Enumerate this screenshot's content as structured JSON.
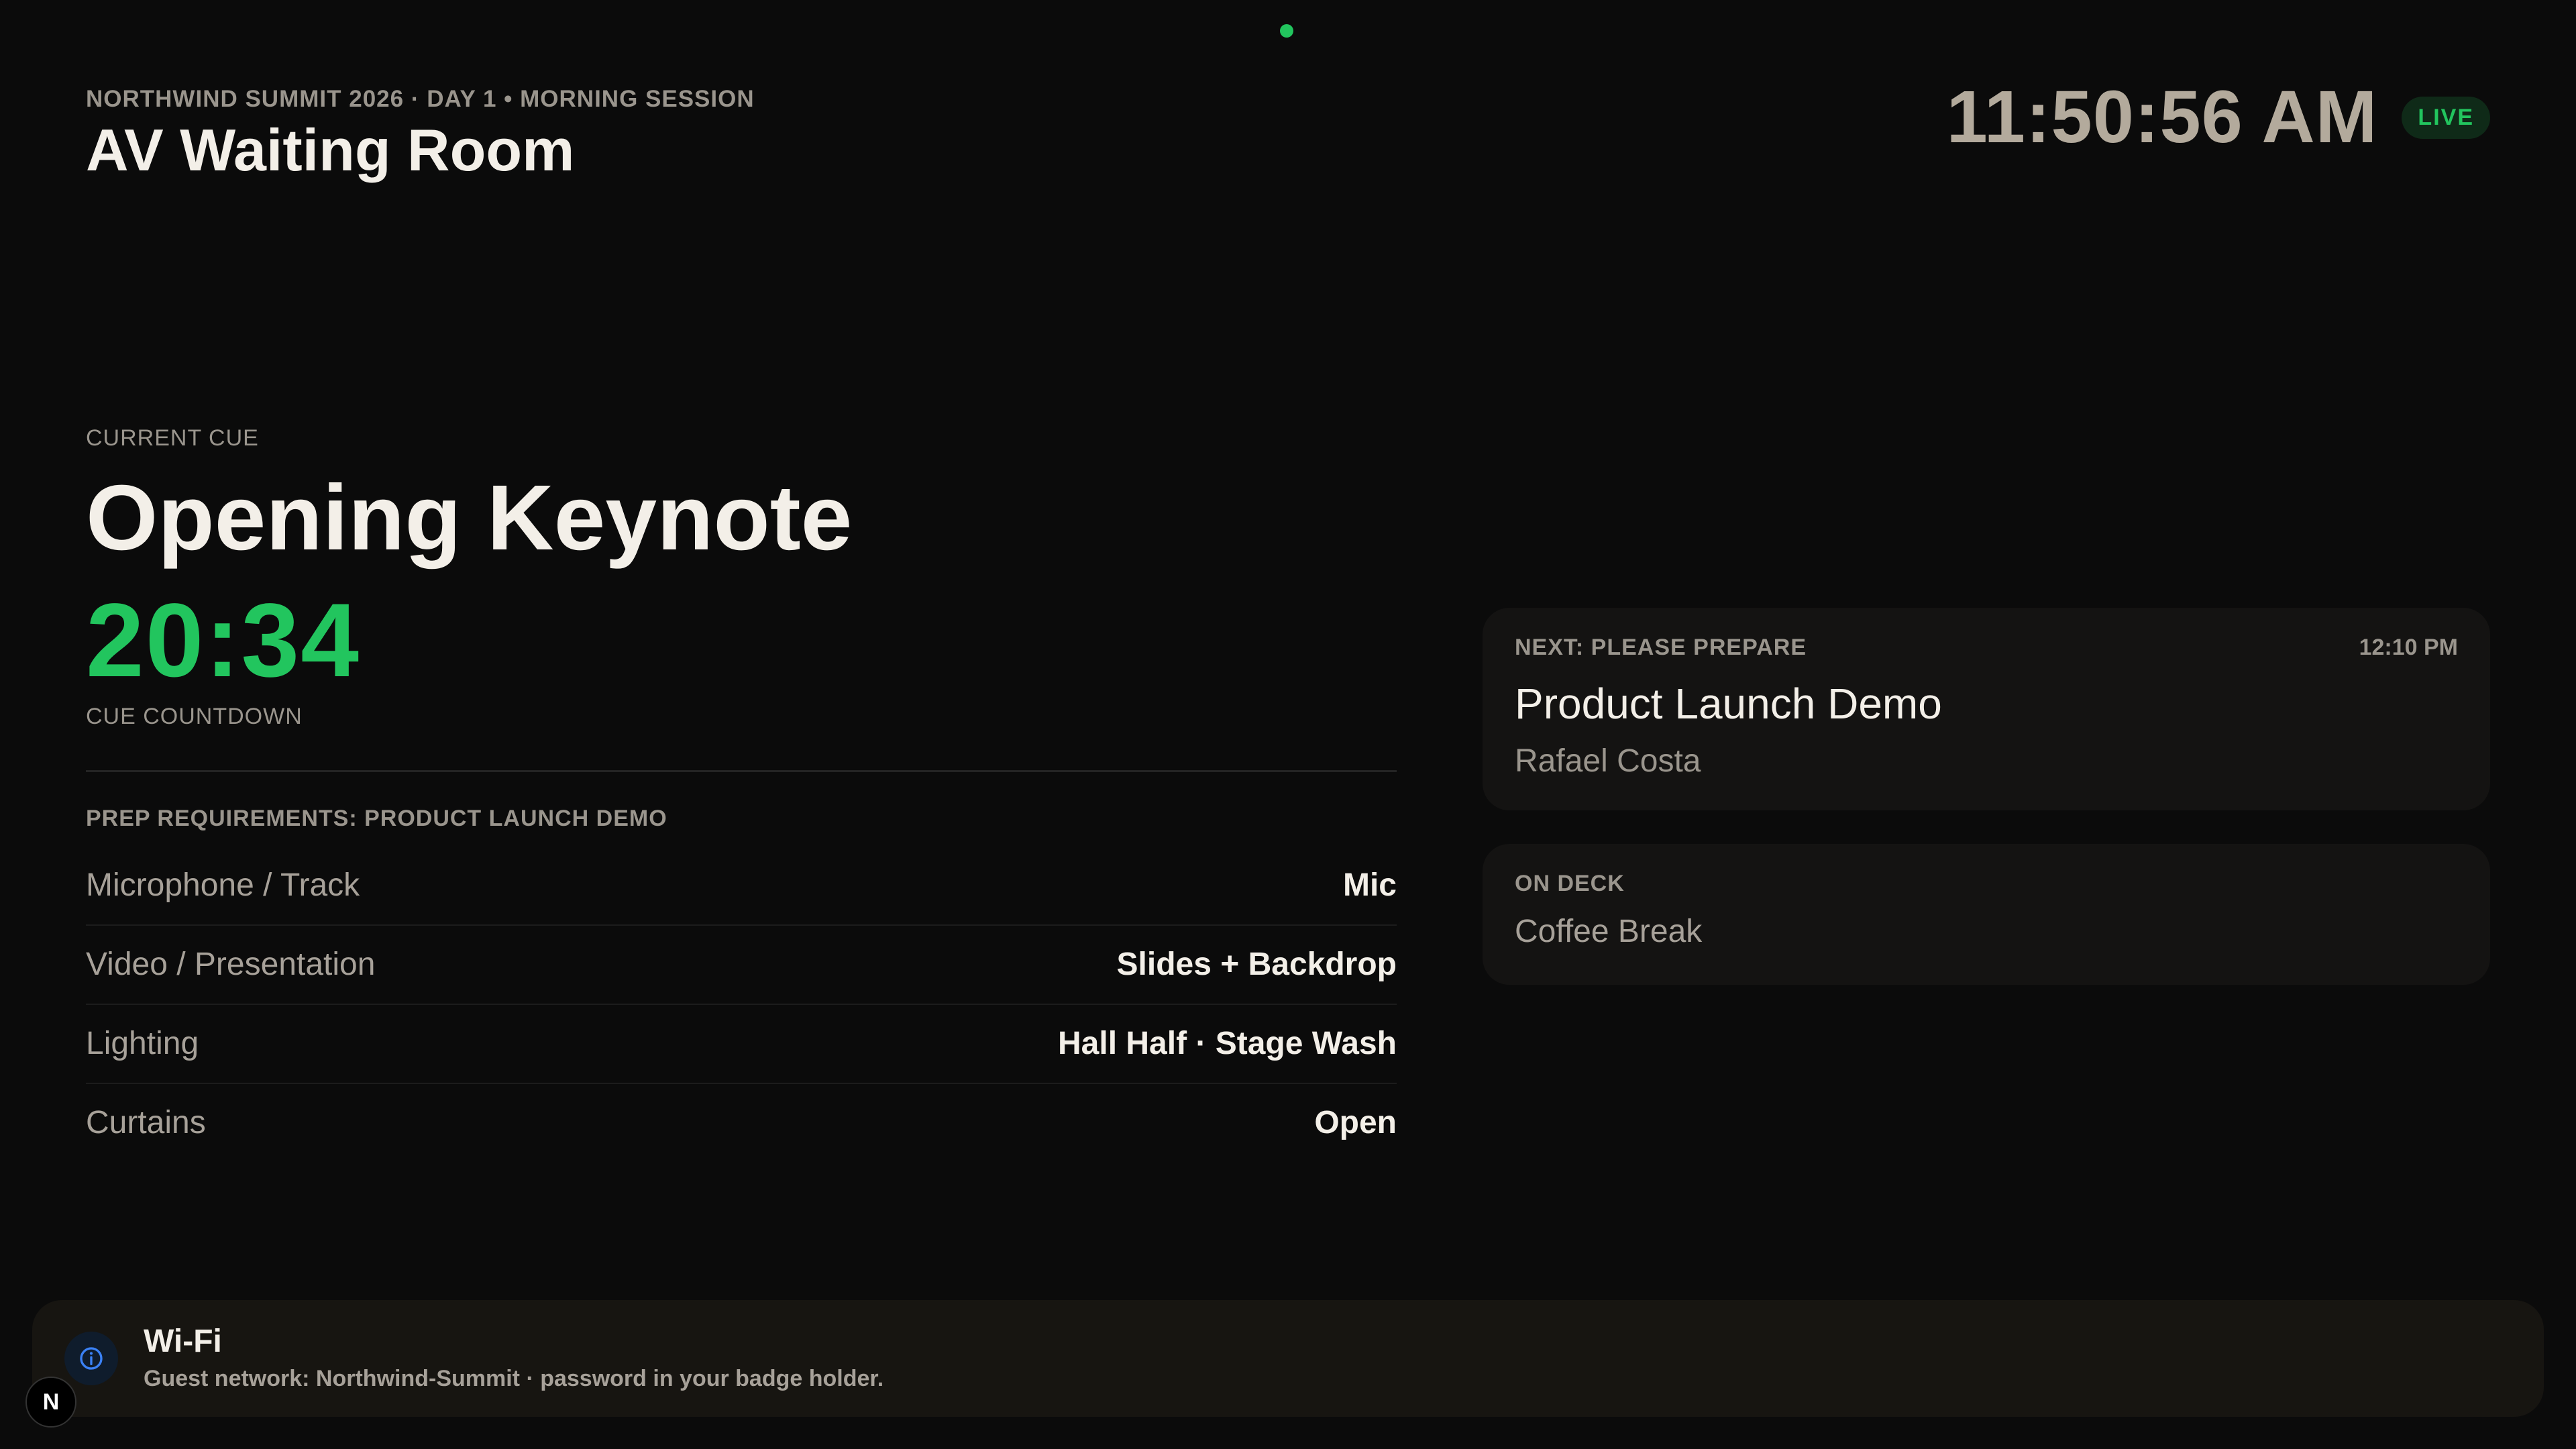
{
  "status": {
    "dot_color": "#22c55e"
  },
  "header": {
    "eyebrow": "NORTHWIND SUMMIT 2026 · DAY 1 • MORNING SESSION",
    "title": "AV Waiting Room",
    "clock": "11:50:56 AM",
    "live_badge": "LIVE"
  },
  "current_cue": {
    "label": "CURRENT CUE",
    "title": "Opening Keynote",
    "countdown": "20:34",
    "countdown_label": "CUE COUNTDOWN"
  },
  "prep": {
    "title": "PREP REQUIREMENTS: PRODUCT LAUNCH DEMO",
    "rows": [
      {
        "label": "Microphone / Track",
        "value": "Mic"
      },
      {
        "label": "Video / Presentation",
        "value": "Slides + Backdrop"
      },
      {
        "label": "Lighting",
        "value": "Hall Half · Stage Wash"
      },
      {
        "label": "Curtains",
        "value": "Open"
      }
    ]
  },
  "next": {
    "label": "NEXT: PLEASE PREPARE",
    "time": "12:10 PM",
    "title": "Product Launch Demo",
    "speaker": "Rafael Costa"
  },
  "on_deck": {
    "label": "ON DECK",
    "title": "Coffee Break"
  },
  "notice": {
    "icon": "info-icon",
    "title": "Wi-Fi",
    "text": "Guest network: Northwind-Summit · password in your badge holder."
  },
  "corner_badge": {
    "letter": "N"
  },
  "colors": {
    "accent_green": "#22c55e",
    "info_blue": "#3b82f6",
    "background": "#0b0b0b"
  }
}
